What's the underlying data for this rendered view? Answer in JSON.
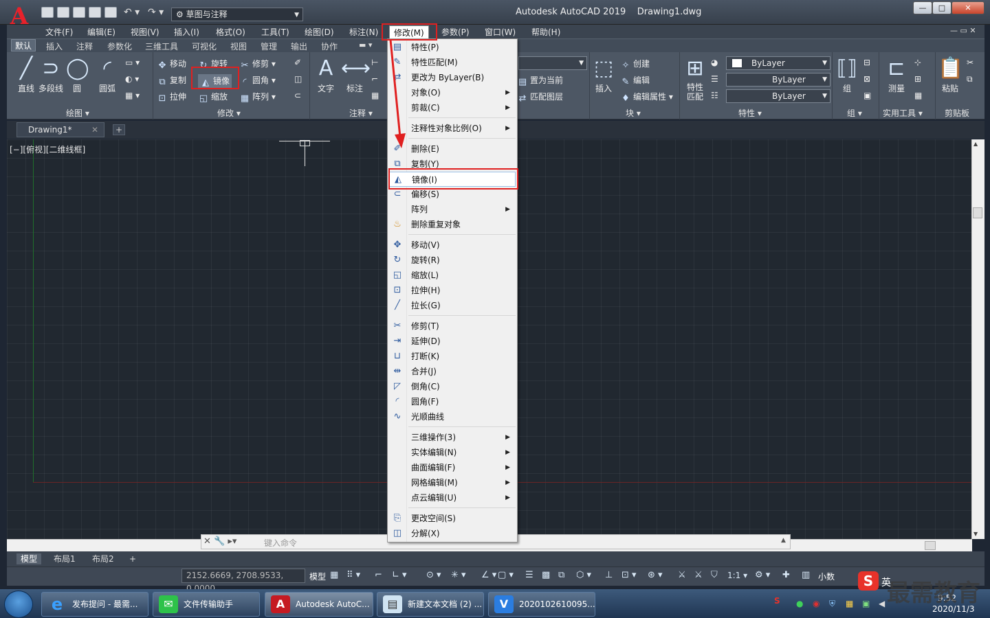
{
  "title": {
    "app": "Autodesk AutoCAD 2019",
    "file": "Drawing1.dwg",
    "workspace": "草图与注释"
  },
  "menubar": [
    "文件(F)",
    "编辑(E)",
    "视图(V)",
    "插入(I)",
    "格式(O)",
    "工具(T)",
    "绘图(D)",
    "标注(N)",
    "修改(M)",
    "参数(P)",
    "窗口(W)",
    "帮助(H)"
  ],
  "ribbon_tabs": [
    "默认",
    "插入",
    "注释",
    "参数化",
    "三维工具",
    "可视化",
    "视图",
    "管理",
    "输出",
    "协作"
  ],
  "ribbon": {
    "draw": {
      "line": "直线",
      "polyline": "多段线",
      "circle": "圆",
      "arc": "圆弧",
      "panel": "绘图"
    },
    "modify": {
      "move": "移动",
      "rotate": "旋转",
      "trim": "修剪",
      "copy": "复制",
      "mirror": "镜像",
      "fillet": "圆角",
      "stretch": "拉伸",
      "scale": "缩放",
      "array": "阵列",
      "panel": "修改"
    },
    "annotate": {
      "text": "文字",
      "dim": "标注",
      "panel": "注释"
    },
    "layers": {
      "set_current": "置为当前",
      "match": "匹配图层"
    },
    "block": {
      "insert": "插入",
      "create": "创建",
      "edit": "编辑",
      "edit_attr": "编辑属性",
      "panel": "块"
    },
    "props": {
      "match": "特性",
      "match2": "匹配",
      "bylayer1": "ByLayer",
      "bylayer2": "ByLayer",
      "bylayer3": "ByLayer",
      "panel": "特性"
    },
    "group": {
      "group": "组",
      "panel": "组"
    },
    "utils": {
      "measure": "测量",
      "panel": "实用工具"
    },
    "clipboard": {
      "paste": "粘贴",
      "panel": "剪贴板"
    }
  },
  "doc_tab": "Drawing1*",
  "viewport_label": "[−][俯视][二维线框]",
  "dropdown": [
    {
      "label": "特性(P)",
      "icon": "▤"
    },
    {
      "label": "特性匹配(M)",
      "icon": "✎"
    },
    {
      "label": "更改为 ByLayer(B)",
      "icon": "⇄"
    },
    {
      "label": "对象(O)",
      "icon": ""
    },
    {
      "label": "剪裁(C)",
      "icon": ""
    },
    {
      "label": "注释性对象比例(O)",
      "icon": ""
    },
    {
      "label": "删除(E)",
      "icon": "✐"
    },
    {
      "label": "复制(Y)",
      "icon": "⧉"
    },
    {
      "label": "镜像(I)",
      "icon": "◭"
    },
    {
      "label": "偏移(S)",
      "icon": "⊂"
    },
    {
      "label": "阵列",
      "icon": ""
    },
    {
      "label": "删除重复对象",
      "icon": "♨"
    },
    {
      "label": "移动(V)",
      "icon": "✥"
    },
    {
      "label": "旋转(R)",
      "icon": "↻"
    },
    {
      "label": "缩放(L)",
      "icon": "◱"
    },
    {
      "label": "拉伸(H)",
      "icon": "⊡"
    },
    {
      "label": "拉长(G)",
      "icon": "╱"
    },
    {
      "label": "修剪(T)",
      "icon": "✂"
    },
    {
      "label": "延伸(D)",
      "icon": "⇥"
    },
    {
      "label": "打断(K)",
      "icon": "⊔"
    },
    {
      "label": "合并(J)",
      "icon": "⇹"
    },
    {
      "label": "倒角(C)",
      "icon": "◸"
    },
    {
      "label": "圆角(F)",
      "icon": "◜"
    },
    {
      "label": "光顺曲线",
      "icon": "∿"
    },
    {
      "label": "三维操作(3)",
      "icon": ""
    },
    {
      "label": "实体编辑(N)",
      "icon": ""
    },
    {
      "label": "曲面编辑(F)",
      "icon": ""
    },
    {
      "label": "网格编辑(M)",
      "icon": ""
    },
    {
      "label": "点云编辑(U)",
      "icon": ""
    },
    {
      "label": "更改空间(S)",
      "icon": "⎘"
    },
    {
      "label": "分解(X)",
      "icon": "◫"
    }
  ],
  "command_placeholder": "键入命令",
  "layout_tabs": [
    "模型",
    "布局1",
    "布局2"
  ],
  "status": {
    "coords": "2152.6669, 2708.9533, 0.0000",
    "model": "模型",
    "scale": "1:1",
    "decimal": "小数"
  },
  "taskbar": [
    {
      "label": "发布提问 - 最需...",
      "icon": "e"
    },
    {
      "label": "文件传输助手",
      "icon": "✉"
    },
    {
      "label": "Autodesk AutoC...",
      "icon": "A"
    },
    {
      "label": "新建文本文档 (2) ...",
      "icon": "▤"
    },
    {
      "label": "2020102610095...",
      "icon": "V"
    }
  ],
  "clock": {
    "time": "9:52",
    "date": "2020/11/3"
  },
  "ime": {
    "logo": "S",
    "text": "英"
  },
  "watermark": "最需教育"
}
